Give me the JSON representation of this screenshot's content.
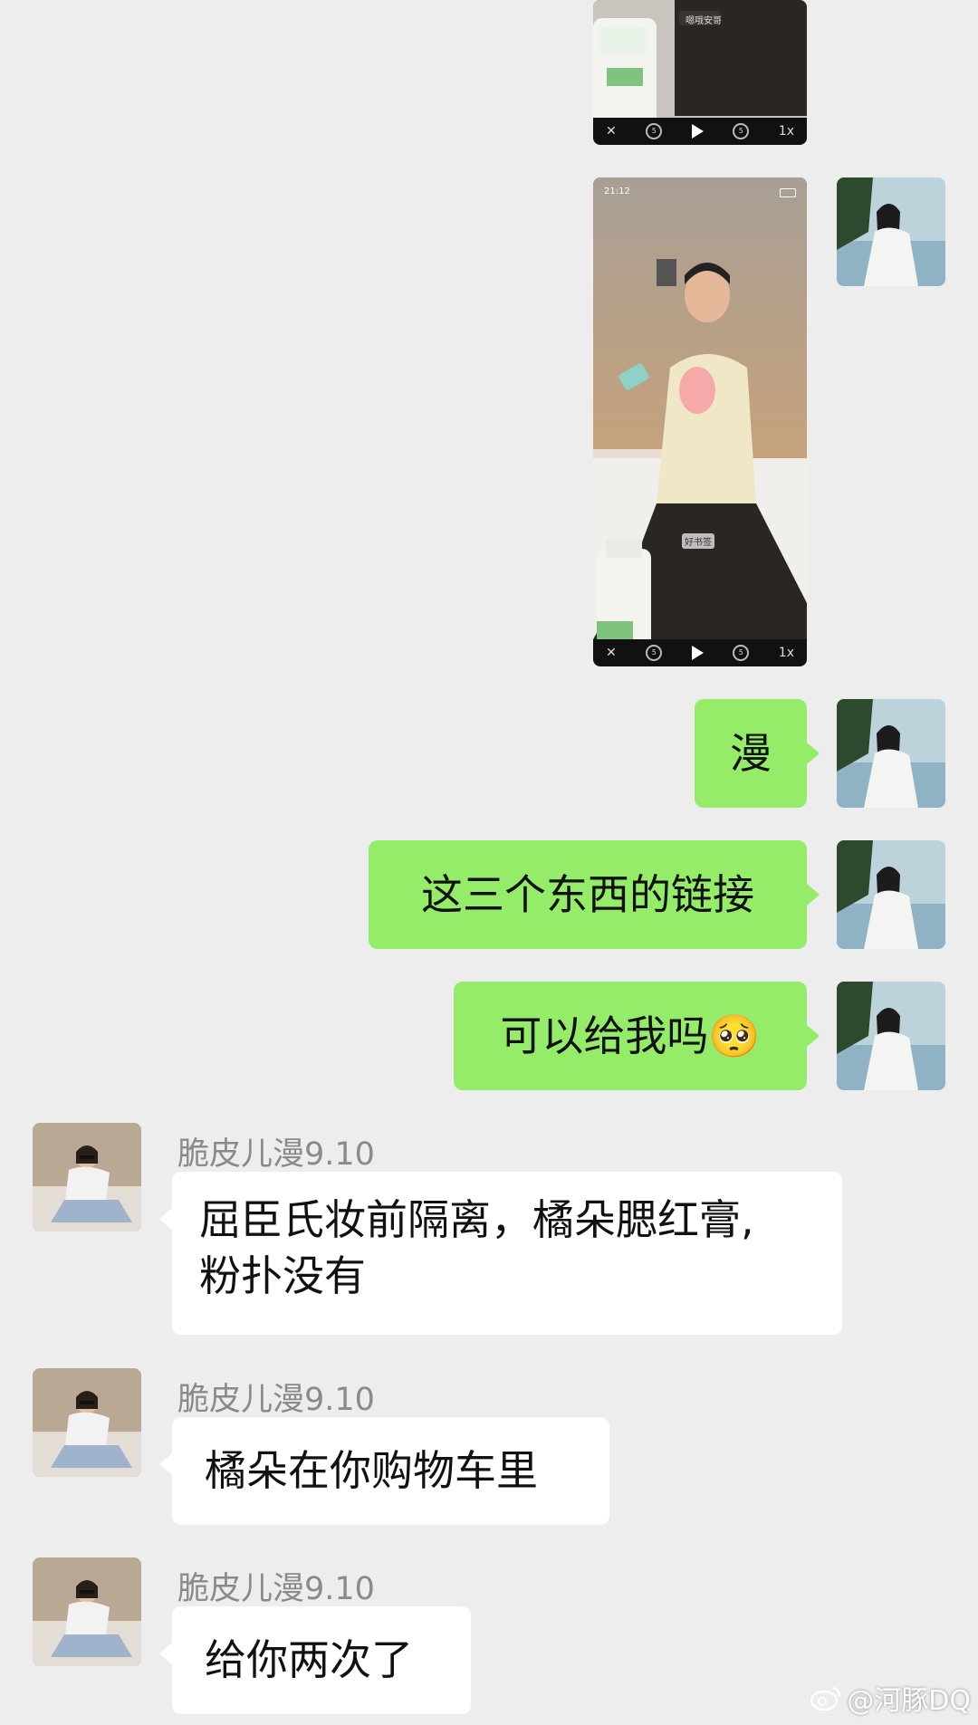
{
  "videos": [
    {
      "status_time": "",
      "overlay_label": "嗯哦安哥",
      "speed": "1x"
    },
    {
      "status_time": "21:12",
      "overlay_label": "好书签",
      "speed": "1x"
    }
  ],
  "messages": [
    {
      "side": "me",
      "text": "漫"
    },
    {
      "side": "me",
      "text": "这三个东西的链接"
    },
    {
      "side": "me",
      "text": "可以给我吗",
      "emoji": "🥺"
    },
    {
      "side": "other",
      "sender": "脆皮儿漫9.10",
      "line1": "屈臣氏妆前隔离，橘朵腮红膏,",
      "line2": "粉扑没有"
    },
    {
      "side": "other",
      "sender": "脆皮儿漫9.10",
      "line1": "橘朵在你购物车里"
    },
    {
      "side": "other",
      "sender": "脆皮儿漫9.10",
      "line1": "给你两次了"
    }
  ],
  "watermark": {
    "text": "@河豚DQ",
    "icon": "weibo-icon"
  },
  "colors": {
    "background": "#ededed",
    "my_bubble": "#95ec69",
    "their_bubble": "#ffffff",
    "sender": "#8a8a8a"
  }
}
